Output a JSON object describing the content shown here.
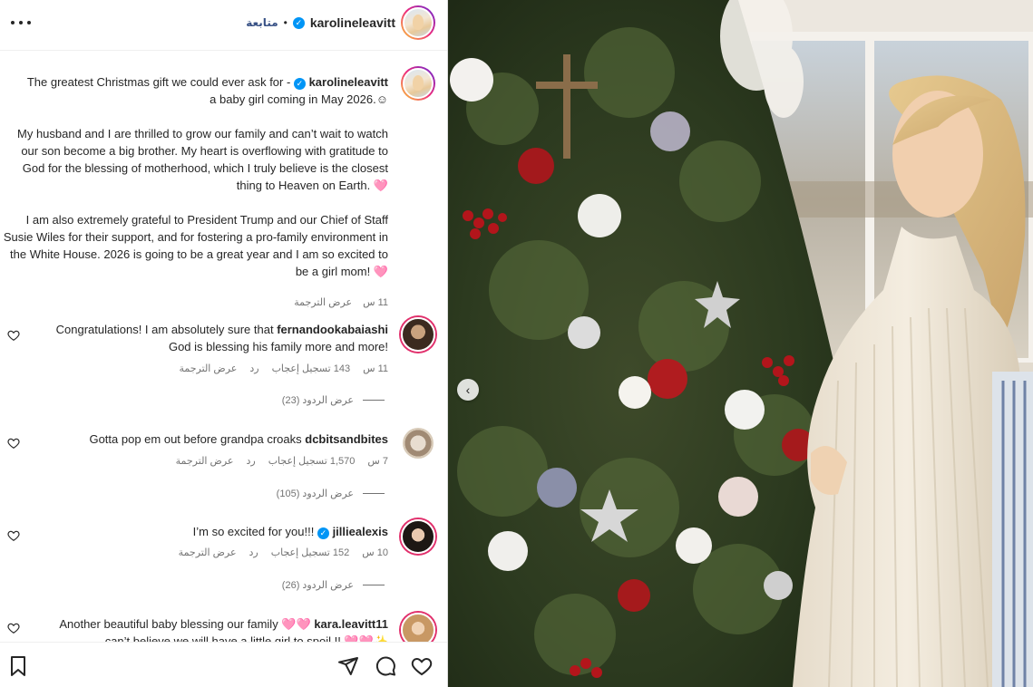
{
  "header": {
    "username": "karolineleavitt",
    "follow_label": "متابعة",
    "separator": "•"
  },
  "caption": {
    "username": "karolineleavitt",
    "line1": "The greatest Christmas gift we could ever ask for -",
    "line2": "a baby girl coming in May 2026.☺",
    "para2": "My husband and I are thrilled to grow our family and can’t wait to watch our son become a big brother. My heart is overflowing with gratitude to God for the blessing of motherhood, which I truly believe is the closest thing to Heaven on Earth. 🩷",
    "para3": "I am also extremely grateful to President Trump and our Chief of Staff Susie Wiles for their support, and for fostering a pro-family environment in the White House. 2026 is going to be a great year and I am so excited to be a girl mom! 🩷",
    "time": "11 س",
    "translate": "عرض الترجمة"
  },
  "comments": [
    {
      "username": "fernandookabaiashi",
      "text": "Congratulations! I am absolutely sure that",
      "text2": "God is blessing his family more and more!",
      "time": "11 س",
      "likes": "143 تسجيل إعجاب",
      "reply": "رد",
      "translate": "عرض الترجمة",
      "replies": "عرض الردود (23)"
    },
    {
      "username": "dcbitsandbites",
      "text": "Gotta pop em out before grandpa croaks",
      "time": "7 س",
      "likes": "1,570 تسجيل إعجاب",
      "reply": "رد",
      "translate": "عرض الترجمة",
      "replies": "عرض الردود (105)"
    },
    {
      "username": "jilliealexis",
      "text": "I’m so excited for you!!!",
      "time": "10 س",
      "likes": "152 تسجيل إعجاب",
      "reply": "رد",
      "translate": "عرض الترجمة",
      "replies": "عرض الردود (26)"
    },
    {
      "username": "kara.leavitt11",
      "text": "Another beautiful baby blessing our family 🩷🩷",
      "text2": "can’t believe we will have a little girl to spoil !! 🩷🩷✨"
    }
  ],
  "icons": {
    "more": "more-options-icon",
    "heart": "heart-icon",
    "comment": "comment-icon",
    "share": "share-icon",
    "save": "bookmark-icon",
    "verified": "verified-badge-icon",
    "prev": "chevron-left-icon"
  },
  "colors": {
    "verified": "#0095f6",
    "follow": "#385185",
    "meta": "#737373"
  }
}
